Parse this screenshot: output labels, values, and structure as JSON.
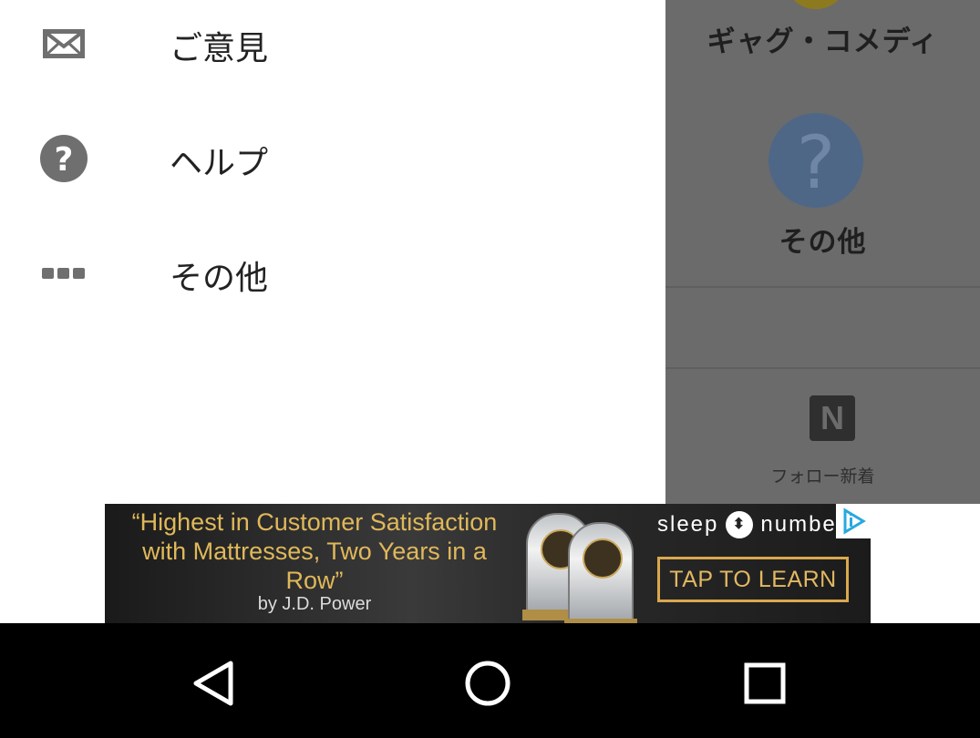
{
  "menu": {
    "items": [
      {
        "label": "ご意見",
        "icon": "envelope-icon"
      },
      {
        "label": "ヘルプ",
        "icon": "help-circle-icon"
      },
      {
        "label": "その他",
        "icon": "more-dots-icon"
      }
    ]
  },
  "background": {
    "category_top_label": "ギャグ・コメディ",
    "category_other_label": "その他",
    "follow_icon_letter": "N",
    "follow_label": "フォロー新着"
  },
  "ad": {
    "quote": "“Highest in Customer Satisfaction with Mattresses, Two Years in a Row”",
    "byline": "by J.D. Power",
    "brand_left": "sleep",
    "brand_right": "numbe",
    "cta": "TAP TO LEARN",
    "colors": {
      "gold": "#d9a84e",
      "choice": "#29a8e0"
    }
  },
  "navbar": {
    "icons": [
      "back-triangle-icon",
      "home-circle-icon",
      "recents-square-icon"
    ]
  },
  "colors": {
    "overlay": "#6b6b6b",
    "question_circle": "#4f6787",
    "icon_gray": "#6f6f6f"
  }
}
